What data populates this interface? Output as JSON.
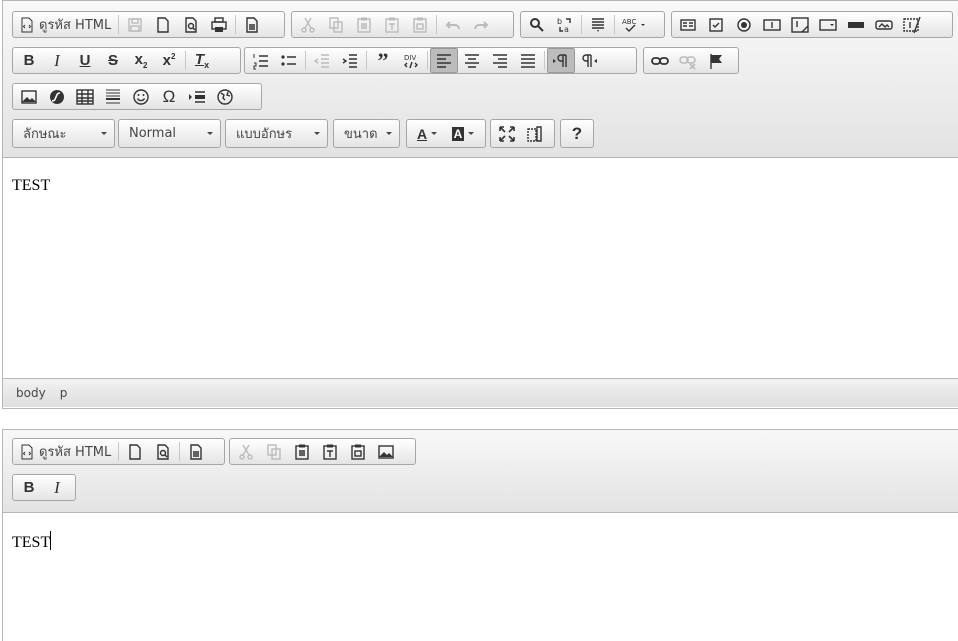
{
  "editor1": {
    "source_label": "ดูรหัส HTML",
    "style_combo": "ลักษณะ",
    "format_combo": "Normal",
    "font_combo": "แบบอักษร",
    "size_combo": "ขนาด",
    "help_label": "?",
    "content_text": "TEST",
    "path_items": [
      "body",
      "p"
    ]
  },
  "editor2": {
    "source_label": "ดูรหัส HTML",
    "content_text": "TEST"
  },
  "colors": {
    "toolbar_top": "#f8f8f8",
    "toolbar_bottom": "#e3e3e3",
    "border": "#b6b6b6",
    "active": "#bcbcbc"
  }
}
